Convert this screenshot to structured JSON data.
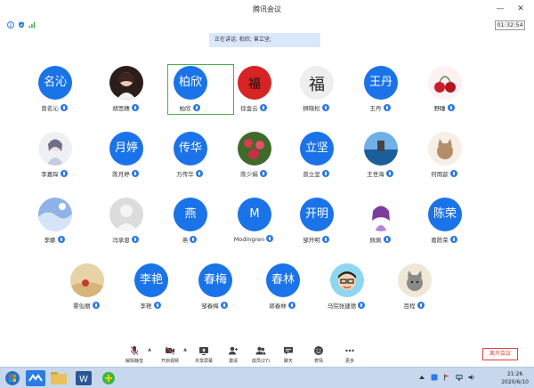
{
  "window": {
    "title": "腾讯会议",
    "min": "—",
    "close": "✕"
  },
  "status": {
    "timer": "01:32:54"
  },
  "speaking": {
    "text": "正在讲话: 柏欣; 曾立坚;"
  },
  "participants": [
    {
      "name": "曾名沁",
      "initials": "名沁",
      "kind": "text"
    },
    {
      "name": "胡思穗",
      "initials": "",
      "kind": "photo-girl"
    },
    {
      "name": "柏欣",
      "initials": "柏欣",
      "kind": "text"
    },
    {
      "name": "徐金云",
      "initials": "",
      "kind": "photo-red"
    },
    {
      "name": "狮晓松",
      "initials": "",
      "kind": "photo-ink"
    },
    {
      "name": "王丹",
      "initials": "王丹",
      "kind": "text"
    },
    {
      "name": "野睡",
      "initials": "",
      "kind": "photo-cherry"
    },
    {
      "name": "李嘉琛",
      "initials": "",
      "kind": "photo-art"
    },
    {
      "name": "陈月婷",
      "initials": "月婷",
      "kind": "text"
    },
    {
      "name": "万传华",
      "initials": "传华",
      "kind": "text"
    },
    {
      "name": "陈少娟",
      "initials": "",
      "kind": "photo-flower"
    },
    {
      "name": "曾立坚",
      "initials": "立坚",
      "kind": "text"
    },
    {
      "name": "王世海",
      "initials": "",
      "kind": "photo-sea"
    },
    {
      "name": "何雨歆",
      "initials": "",
      "kind": "photo-cat"
    },
    {
      "name": "李娜",
      "initials": "",
      "kind": "photo-sky"
    },
    {
      "name": "冯承恩",
      "initials": "",
      "kind": "photo-default"
    },
    {
      "name": "燕",
      "initials": "燕",
      "kind": "text"
    },
    {
      "name": "Modingren",
      "initials": "M",
      "kind": "text"
    },
    {
      "name": "邹开明",
      "initials": "开明",
      "kind": "text"
    },
    {
      "name": "佩佩",
      "initials": "",
      "kind": "photo-purple"
    },
    {
      "name": "葛陈荣",
      "initials": "陈荣",
      "kind": "text"
    },
    {
      "name": "雾仙丽",
      "initials": "",
      "kind": "photo-desert"
    },
    {
      "name": "李艳",
      "initials": "李艳",
      "kind": "text"
    },
    {
      "name": "邹春梅",
      "initials": "春梅",
      "kind": "text"
    },
    {
      "name": "郭春林",
      "initials": "春林",
      "kind": "text"
    },
    {
      "name": "马院张建德",
      "initials": "",
      "kind": "photo-cartoon"
    },
    {
      "name": "百程",
      "initials": "",
      "kind": "photo-kitten"
    }
  ],
  "toolbar": {
    "mute": "解除静音",
    "video": "开启视频",
    "share": "共享屏幕",
    "invite": "邀请",
    "members": "成员(27)",
    "chat": "聊天",
    "reaction": "表情",
    "more": "更多",
    "leave": "离开会议"
  },
  "taskbar": {
    "time": "21:26",
    "date": "2020/6/10"
  },
  "colors": {
    "accent": "#1a73e8",
    "leave": "#e0403a",
    "speaking_bg": "#dbe8fb",
    "highlight": "#4caf50"
  }
}
